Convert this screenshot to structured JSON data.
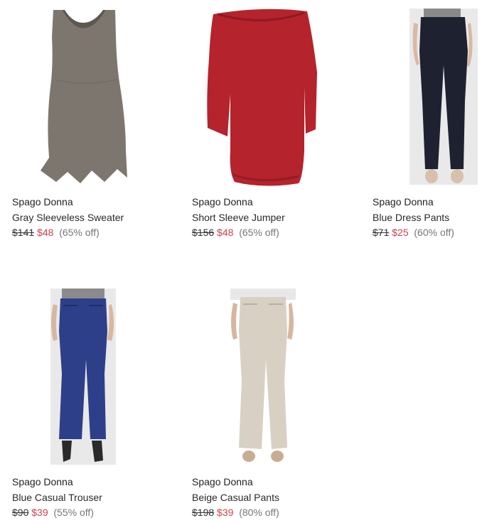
{
  "products": [
    {
      "brand": "Spago Donna",
      "name": "Gray Sleeveless Sweater",
      "original_price": "$141",
      "sale_price": "$48",
      "discount": "(65% off)",
      "image_icon": "gray-sleeveless-sweater-image",
      "color": "#7a736c"
    },
    {
      "brand": "Spago Donna",
      "name": "Short Sleeve Jumper",
      "original_price": "$156",
      "sale_price": "$48",
      "discount": "(65% off)",
      "image_icon": "red-short-sleeve-jumper-image",
      "color": "#b8262e"
    },
    {
      "brand": "Spago Donna",
      "name": "Blue Dress Pants",
      "original_price": "$71",
      "sale_price": "$25",
      "discount": "(60% off)",
      "image_icon": "blue-dress-pants-image",
      "color": "#1c1f2b"
    },
    {
      "brand": "Spago Donna",
      "name": "Blue Casual Trouser",
      "original_price": "$90",
      "sale_price": "$39",
      "discount": "(55% off)",
      "image_icon": "blue-casual-trouser-image",
      "color": "#2e3f8a"
    },
    {
      "brand": "Spago Donna",
      "name": "Beige Casual Pants",
      "original_price": "$198",
      "sale_price": "$39",
      "discount": "(80% off)",
      "image_icon": "beige-casual-pants-image",
      "color": "#d8d0c2"
    }
  ],
  "colors": {
    "sale_price": "#d0404f",
    "discount": "#777777",
    "text": "#222222"
  }
}
